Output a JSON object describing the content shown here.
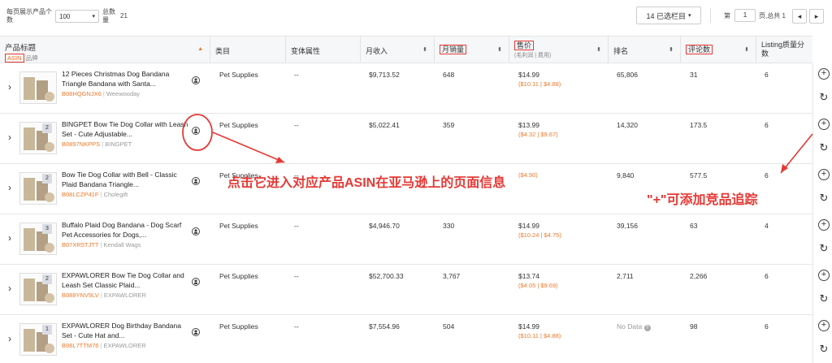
{
  "toolbar": {
    "per_page_label": "每页展示产品个数",
    "per_page_value": "100",
    "total_label": "总数量",
    "total_value": "21",
    "columns_button": "14 已选栏目",
    "page_prefix": "第",
    "page_value": "1",
    "page_suffix": "页,总共 1"
  },
  "header": {
    "title": "产品标题",
    "asin": "ASIN",
    "brand": "品牌",
    "category": "类目",
    "variant": "变体属性",
    "monthly_revenue": "月收入",
    "monthly_sales": "月销量",
    "price": "售价",
    "price_sub": "(毛利润 | 费用)",
    "rank": "排名",
    "reviews": "评论数",
    "listing_quality": "Listing质量分数"
  },
  "rows": [
    {
      "title": "12 Pieces Christmas Dog Bandana Triangle Bandana with Santa...",
      "asin": "B08HQGNJX6",
      "brand": "Weewooday",
      "badge": "",
      "category": "Pet Supplies",
      "variant": "--",
      "revenue": "$9,713.52",
      "sales": "648",
      "price": "$14.99",
      "price_sub": "($10.11 | $4.88)",
      "rank": "65,806",
      "reviews": "31",
      "quality": "6"
    },
    {
      "title": "BINGPET Bow Tie Dog Collar with Leash Set - Cute Adjustable...",
      "asin": "B0897NKPPS",
      "brand": "BINGPET",
      "badge": "2",
      "category": "Pet Supplies",
      "variant": "--",
      "revenue": "$5,022.41",
      "sales": "359",
      "price": "$13.99",
      "price_sub": "($4.32 | $9.67)",
      "rank": "14,320",
      "reviews": "173.5",
      "quality": "6"
    },
    {
      "title": "Bow Tie Dog Collar with Bell - Classic Plaid Bandana Triangle...",
      "asin": "B08LCZP41F",
      "brand": "Cholegift",
      "badge": "2",
      "category": "Pet Supplies",
      "variant": "--",
      "revenue": "",
      "sales": "",
      "price": "",
      "price_sub": "($4.90)",
      "rank": "9,840",
      "reviews": "577.5",
      "quality": "6"
    },
    {
      "title": "Buffalo Plaid Dog Bandana - Dog Scarf Pet Accessories for Dogs,...",
      "asin": "B07XR5TJTT",
      "brand": "Kendall Wags",
      "badge": "3",
      "category": "Pet Supplies",
      "variant": "--",
      "revenue": "$4,946.70",
      "sales": "330",
      "price": "$14.99",
      "price_sub": "($10.24 | $4.75)",
      "rank": "39,156",
      "reviews": "63",
      "quality": "4"
    },
    {
      "title": "EXPAWLORER Bow Tie Dog Collar and Leash Set Classic Plaid...",
      "asin": "B088YNV9LV",
      "brand": "EXPAWLORER",
      "badge": "2",
      "category": "Pet Supplies",
      "variant": "--",
      "revenue": "$52,700.33",
      "sales": "3,767",
      "price": "$13.74",
      "price_sub": "($4.05 | $9.69)",
      "rank": "2,711",
      "reviews": "2,266",
      "quality": "6"
    },
    {
      "title": "EXPAWLORER Dog Birthday Bandana Set - Cute Hat and...",
      "asin": "B08L7TTM76",
      "brand": "EXPAWLORER",
      "badge": "1",
      "category": "Pet Supplies",
      "variant": "--",
      "revenue": "$7,554.96",
      "sales": "504",
      "price": "$14.99",
      "price_sub": "($10.11 | $4.88)",
      "rank": "No Data",
      "reviews": "98",
      "quality": "6"
    }
  ],
  "annotations": {
    "asin_note": "点击它进入对应产品ASIN在亚马逊上的页面信息",
    "plus_note": "\"+\"可添加竞品追踪"
  },
  "colors": {
    "accent": "#f0782a",
    "annotation": "#e53935"
  }
}
